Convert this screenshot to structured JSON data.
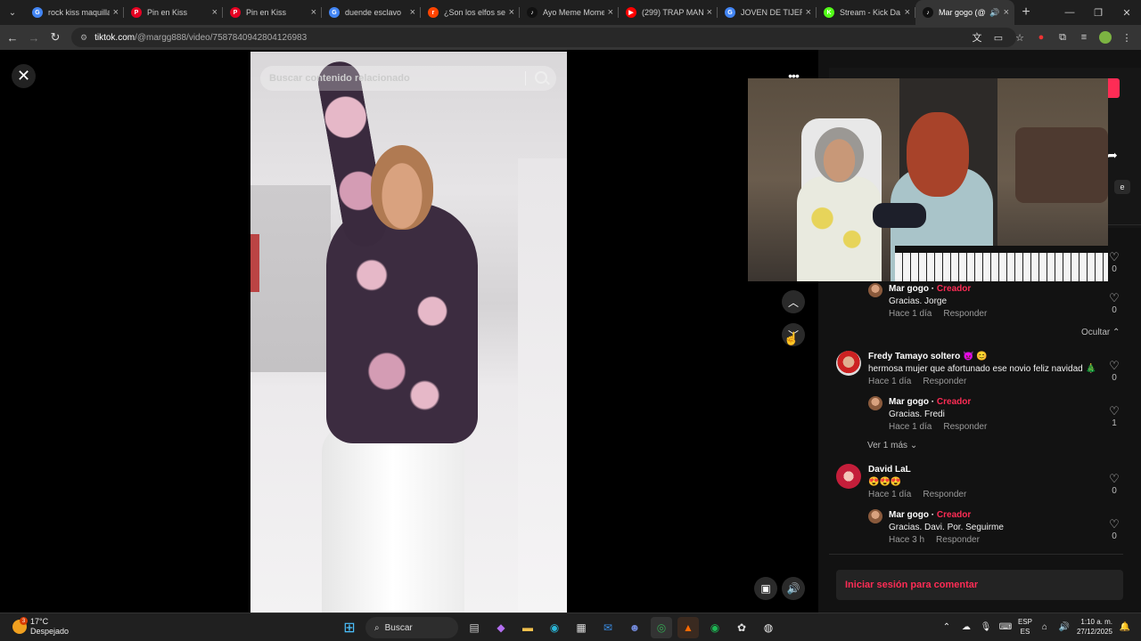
{
  "browser": {
    "tabs": [
      {
        "title": "rock kiss maquilla",
        "favicon": "google-icon",
        "color": "#4285f4",
        "glyph": "G"
      },
      {
        "title": "Pin en Kiss",
        "favicon": "pinterest-icon",
        "color": "#e60023",
        "glyph": "P"
      },
      {
        "title": "Pin en Kiss",
        "favicon": "pinterest-icon",
        "color": "#e60023",
        "glyph": "P"
      },
      {
        "title": "duende esclavo",
        "favicon": "google-icon",
        "color": "#4285f4",
        "glyph": "G"
      },
      {
        "title": "¿Son los elfos se",
        "favicon": "reddit-icon",
        "color": "#ff4500",
        "glyph": "r"
      },
      {
        "title": "Ayo Meme Mome",
        "favicon": "tiktok-icon",
        "color": "#111111",
        "glyph": "♪"
      },
      {
        "title": "(299) TRAP MAN",
        "favicon": "youtube-icon",
        "color": "#ff0000",
        "glyph": "▶"
      },
      {
        "title": "JOVEN DE TIJERA",
        "favicon": "google-icon",
        "color": "#4285f4",
        "glyph": "G"
      },
      {
        "title": "Stream - Kick Da",
        "favicon": "kick-icon",
        "color": "#53fc18",
        "glyph": "K"
      },
      {
        "title": "Mar gogo (@",
        "favicon": "tiktok-icon",
        "color": "#111111",
        "glyph": "♪",
        "active": true
      }
    ],
    "url_domain": "tiktok.com",
    "url_path": "/@margg888/video/7587840942804126983"
  },
  "search": {
    "placeholder": "Buscar contenido relacionado"
  },
  "comments": [
    {
      "user": "Mar gogo",
      "creator": "Creador",
      "text": "Gracias. Jorge",
      "time": "Hace 1 día",
      "reply": "Responder",
      "likes": "0",
      "nested": true
    },
    {
      "user": "Fredy Tamayo soltero 👿 😊",
      "text": "hermosa mujer que afortunado ese novio feliz navidad 🎄",
      "time": "Hace 1 día",
      "reply": "Responder",
      "likes": "0"
    },
    {
      "user": "Mar gogo",
      "creator": "Creador",
      "text": "Gracias. Fredi",
      "time": "Hace 1 día",
      "reply": "Responder",
      "likes": "1",
      "nested": true
    },
    {
      "user": "David LaL",
      "text": "😍😍😍",
      "time": "Hace 1 día",
      "reply": "Responder",
      "likes": "0"
    },
    {
      "user": "Mar gogo",
      "creator": "Creador",
      "text": "Gracias. Davi. Por. Seguirme",
      "time": "Hace 3 h",
      "reply": "Responder",
      "likes": "0",
      "nested": true
    }
  ],
  "top_like": {
    "likes": "0"
  },
  "hide_label": "Ocultar",
  "more_label": "Ver 1 más",
  "login_label": "Iniciar sesión para comentar",
  "taskbar": {
    "temp": "17°C",
    "weather": "Despejado",
    "weather_badge": "3",
    "search": "Buscar",
    "lang1": "ESP",
    "lang2": "ES",
    "time": "1:10 a. m.",
    "date": "27/12/2025"
  }
}
